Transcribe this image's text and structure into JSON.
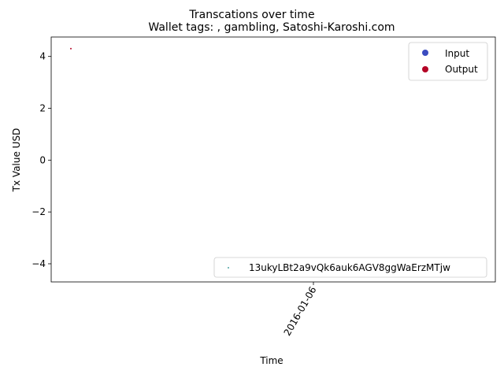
{
  "chart_data": {
    "type": "scatter",
    "suptitle": "Transcations over time",
    "title": "Wallet tags: , gambling, Satoshi-Karoshi.com",
    "xlabel": "Time",
    "ylabel": "Tx Value USD",
    "x_tick_labels": [
      "2016-01-06"
    ],
    "y_ticks": [
      4,
      2,
      0,
      -2,
      -4
    ],
    "y_tick_labels": [
      "4",
      "2",
      "0",
      "−2",
      "−4"
    ],
    "ylim": [
      -4.7,
      4.75
    ],
    "grid": false,
    "series": [
      {
        "name": "Input",
        "color": "#3b4cc0",
        "points": []
      },
      {
        "name": "Output",
        "color": "#b40426",
        "points": [
          {
            "x": "2016-01-06",
            "y": 4.3
          }
        ]
      }
    ],
    "legend_main": {
      "placement": "top-right",
      "items": [
        {
          "label": "Input",
          "color": "#3b4cc0"
        },
        {
          "label": "Output",
          "color": "#b40426"
        }
      ]
    },
    "legend_wallet": {
      "placement": "bottom-right",
      "items": [
        {
          "label": "13ukyLBt2a9vQk6auk6AGV8ggWaErzMTjw",
          "color": "#1a8a8a"
        }
      ]
    }
  }
}
